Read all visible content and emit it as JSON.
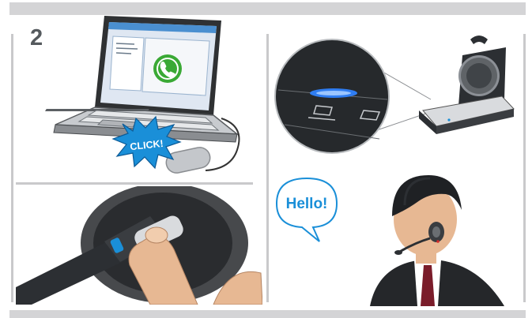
{
  "step_number": "2",
  "callouts": {
    "click": "CLICK!",
    "greeting": "Hello!"
  },
  "colors": {
    "frame_gray": "#d4d4d6",
    "divider_gray": "#c9c9cb",
    "accent_blue": "#1a8fd8",
    "led_blue": "#2f7df2",
    "phone_green": "#3aa935"
  }
}
